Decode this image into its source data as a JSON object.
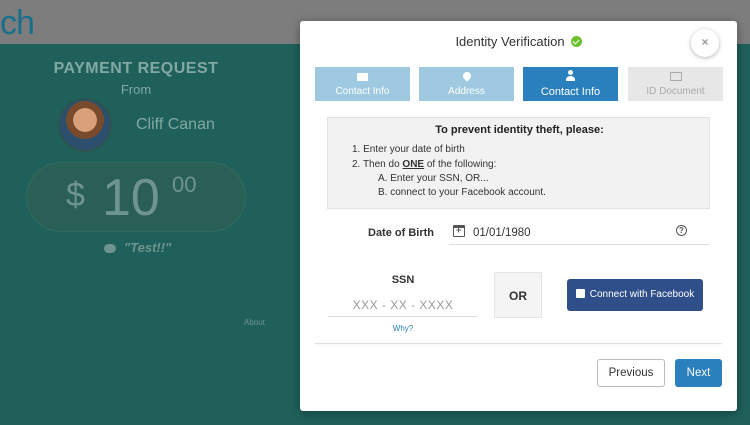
{
  "background": {
    "logo_text": "ch",
    "title": "PAYMENT REQUEST",
    "from_label": "From",
    "sender_name": "Cliff Canan",
    "amount_dollar_sign": "$",
    "amount_whole": "10",
    "amount_cents": "00",
    "note": "\"Test!!\"",
    "about_link": "About"
  },
  "modal": {
    "title": "Identity Verification",
    "close_label": "×",
    "steps": [
      {
        "label": "Contact Info",
        "icon": "envelope-icon",
        "state": "done"
      },
      {
        "label": "Address",
        "icon": "map-marker-icon",
        "state": "done"
      },
      {
        "label": "Contact Info",
        "icon": "user-icon",
        "state": "active"
      },
      {
        "label": "ID Document",
        "icon": "picture-icon",
        "state": "todo"
      }
    ],
    "instructions": {
      "heading": "To prevent identity theft, please:",
      "line1": "1. Enter your date of birth",
      "line2_prefix": "2. Then do ",
      "line2_emphasis": "ONE",
      "line2_suffix": " of the following:",
      "line3": "A. Enter your SSN, OR...",
      "line4": "B. connect to your Facebook account."
    },
    "dob": {
      "label": "Date of Birth",
      "value": "01/01/1980"
    },
    "ssn": {
      "label": "SSN",
      "placeholder": "XXX - XX - XXXX",
      "help_link": "Why?"
    },
    "or_label": "OR",
    "facebook_button": "Connect with Facebook",
    "previous_button": "Previous",
    "next_button": "Next"
  },
  "colors": {
    "primary": "#2a7fbd",
    "facebook": "#2f4f8b",
    "step_done": "#9ec9e0",
    "background_teal": "#1f615a",
    "success": "#6cbf2f"
  }
}
